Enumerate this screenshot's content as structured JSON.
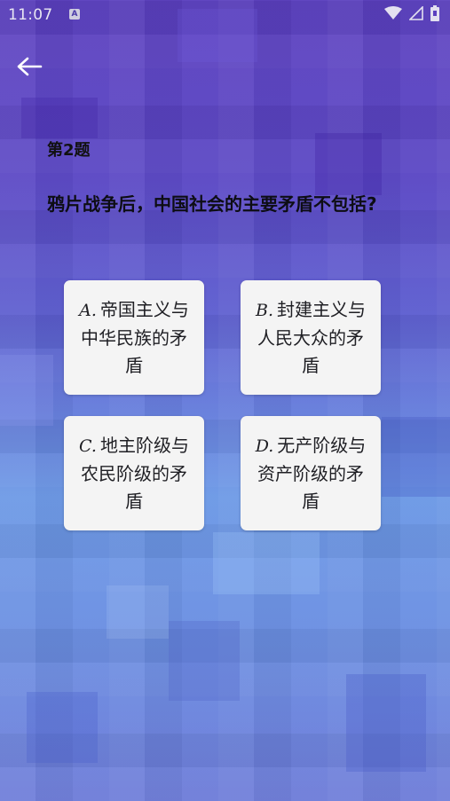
{
  "status_bar": {
    "time": "11:07",
    "notification_glyph": "A",
    "icons": [
      "wifi-icon",
      "cell-signal-icon",
      "battery-icon"
    ]
  },
  "nav": {
    "back_icon": "arrow-left-icon"
  },
  "question": {
    "number_label": "第2题",
    "text": "鸦片战争后，中国社会的主要矛盾不包括?"
  },
  "options": [
    {
      "letter": "A.",
      "text": "帝国主义与中华民族的矛盾"
    },
    {
      "letter": "B.",
      "text": "封建主义与人民大众的矛盾"
    },
    {
      "letter": "C.",
      "text": "地主阶级与农民阶级的矛盾"
    },
    {
      "letter": "D.",
      "text": "无产阶级与资产阶级的矛盾"
    }
  ],
  "colors": {
    "card_background": "#f4f4f4",
    "text_primary": "#111111",
    "background_top": "#5b3fbf",
    "background_mid": "#6b98e6",
    "background_bottom": "#6b7ad8"
  }
}
